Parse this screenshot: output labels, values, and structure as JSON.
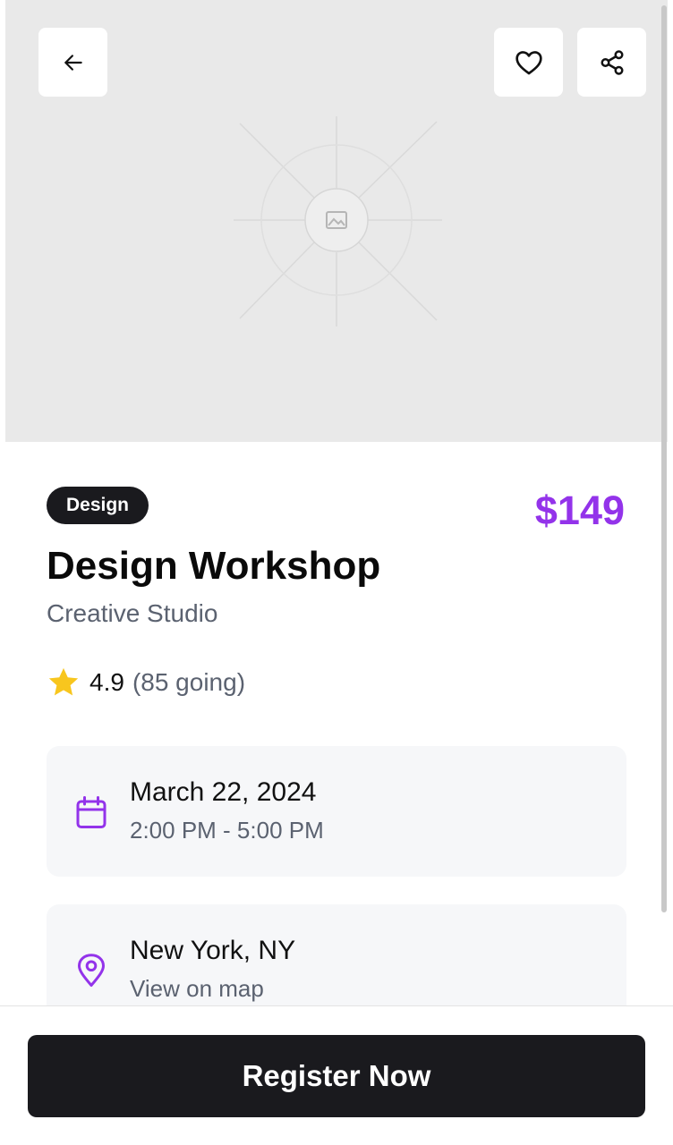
{
  "hero": {
    "image_placeholder_icon": "image-icon",
    "background": "#e9e9e9"
  },
  "top_bar": {
    "back_icon": "arrow-left-icon",
    "favorite_icon": "heart-icon",
    "share_icon": "share-icon"
  },
  "event": {
    "category": "Design",
    "price": "$149",
    "title": "Design Workshop",
    "organizer": "Creative Studio",
    "rating": "4.9",
    "attendance": "(85 going)",
    "date": "March 22, 2024",
    "time": "2:00 PM - 5:00 PM",
    "location": "New York, NY",
    "map_link": "View on map"
  },
  "icons": {
    "rating": "star-icon",
    "date": "calendar-icon",
    "location": "map-pin-icon"
  },
  "actions": {
    "register_label": "Register Now"
  },
  "colors": {
    "accent": "#9333ea",
    "dark": "#1a1a1e",
    "muted_text": "#5b6270",
    "card_bg": "#f6f7f9",
    "star": "#f8c61e"
  }
}
